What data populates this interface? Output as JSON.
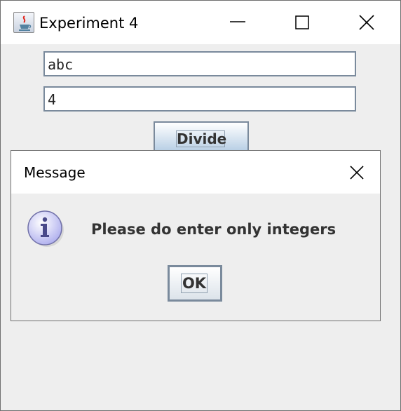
{
  "window": {
    "title": "Experiment 4",
    "icon": "java-coffee-icon"
  },
  "form": {
    "field_1_value": "abc",
    "field_2_value": "4",
    "divide_label": "Divide"
  },
  "dialog": {
    "title": "Message",
    "icon": "info-icon",
    "message": "Please do enter only integers",
    "ok_label": "OK"
  },
  "colors": {
    "background": "#eeeeee",
    "titlebar": "#ffffff",
    "button_border": "#7a8a9c",
    "info_icon": "#c9c9f5"
  }
}
